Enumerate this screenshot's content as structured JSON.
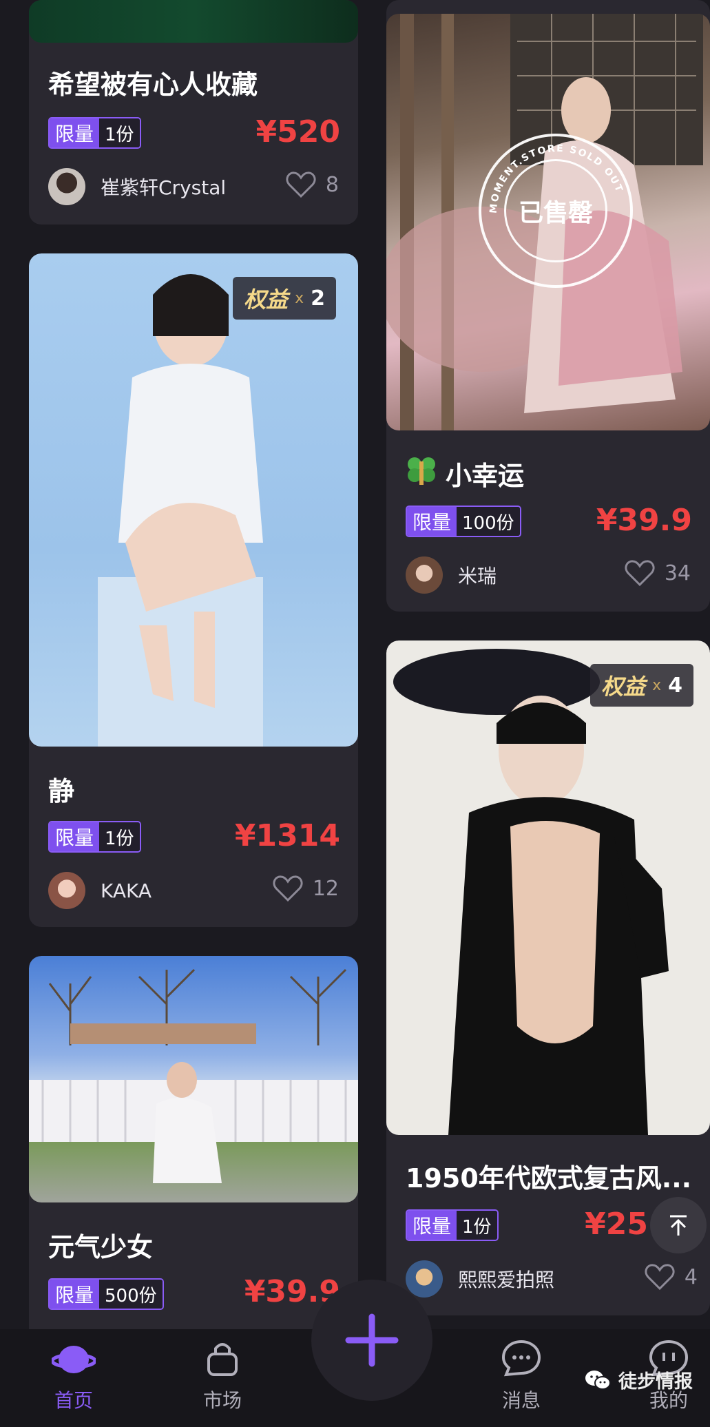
{
  "cards": [
    {
      "title": "希望被有心人收藏",
      "limit_label": "限量",
      "quantity": "1份",
      "price": "¥520",
      "creator": "崔紫轩Crystal",
      "likes": "8"
    },
    {
      "title": "小幸运",
      "limit_label": "限量",
      "quantity": "100份",
      "price": "¥39.9",
      "creator": "米瑞",
      "likes": "34",
      "sold_out_label": "已售罄",
      "sold_out_ring_text": "MOMENT.STORE SOLD OUT"
    },
    {
      "title": "静",
      "limit_label": "限量",
      "quantity": "1份",
      "price": "¥1314",
      "creator": "KAKA",
      "likes": "12",
      "rights_label": "权益",
      "rights_x": "x",
      "rights_count": "2"
    },
    {
      "title": "1950年代欧式复古风...",
      "limit_label": "限量",
      "quantity": "1份",
      "price": "¥25",
      "creator": "熙熙爱拍照",
      "likes": "4",
      "rights_label": "权益",
      "rights_x": "x",
      "rights_count": "4"
    },
    {
      "title": "元气少女",
      "limit_label": "限量",
      "quantity": "500份",
      "price": "¥39.9"
    }
  ],
  "tabbar": {
    "home": "首页",
    "market": "市场",
    "messages": "消息",
    "profile": "我的"
  },
  "watermark": "徒步情报",
  "colors": {
    "accent": "#8a5cf6",
    "price": "#f04343",
    "background": "#1b1a20",
    "card": "#2a2830"
  }
}
